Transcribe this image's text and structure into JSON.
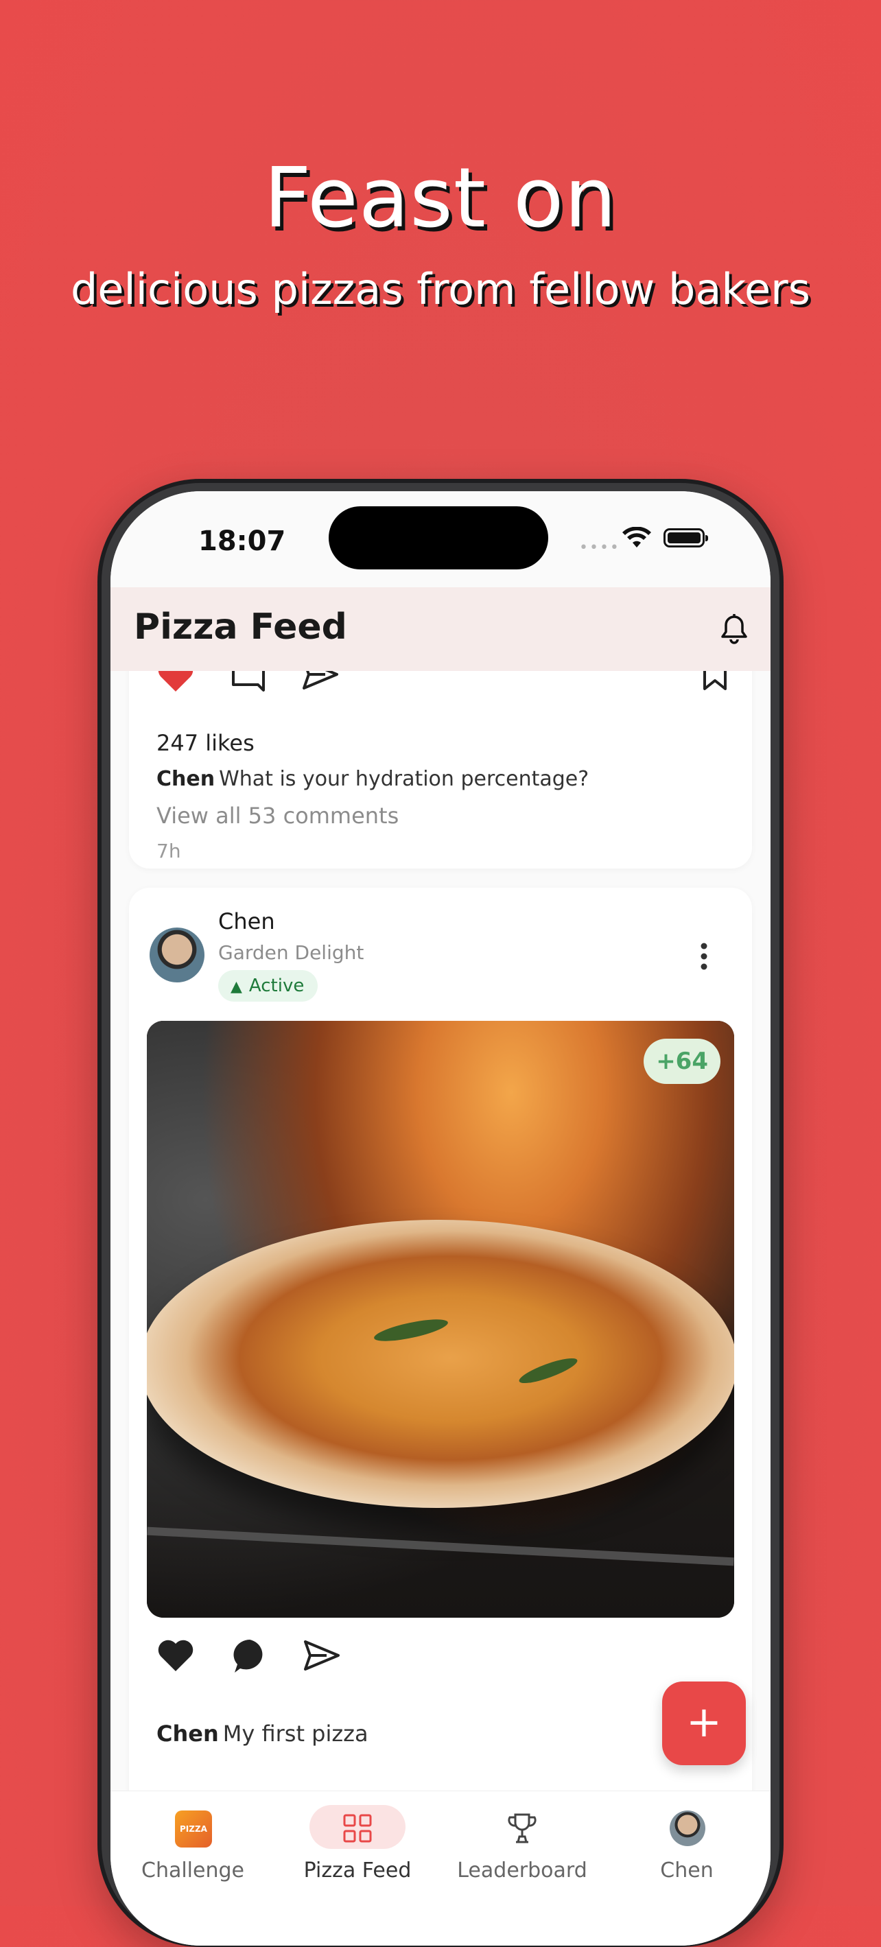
{
  "promo": {
    "headline": "Feast on",
    "subheadline": "delicious pizzas from fellow bakers"
  },
  "status_bar": {
    "time": "18:07"
  },
  "header": {
    "title": "Pizza Feed"
  },
  "post_1": {
    "likes": "247 likes",
    "author": "Chen",
    "caption": "What is your hydration percentage?",
    "view_comments": "View all 53 comments",
    "time_ago": "7h",
    "liked": true
  },
  "post_2": {
    "user_name": "Chen",
    "pizza_name": "Garden Delight",
    "status": "Active",
    "points": "+64",
    "author": "Chen",
    "caption": "My first pizza"
  },
  "fab": {
    "label": "+"
  },
  "tabs": [
    {
      "label": "Challenge",
      "icon": "challenge-logo-icon",
      "active": false
    },
    {
      "label": "Pizza Feed",
      "icon": "grid-icon",
      "active": true
    },
    {
      "label": "Leaderboard",
      "icon": "trophy-icon",
      "active": false
    },
    {
      "label": "Chen",
      "icon": "avatar-icon",
      "active": false
    }
  ],
  "colors": {
    "background": "#e84b4b",
    "accent": "#e84848",
    "header_bg": "#f6ebea",
    "active_badge_bg": "#e8f6ec",
    "active_badge_text": "#1e7a3a",
    "points_text": "#4aa466"
  }
}
